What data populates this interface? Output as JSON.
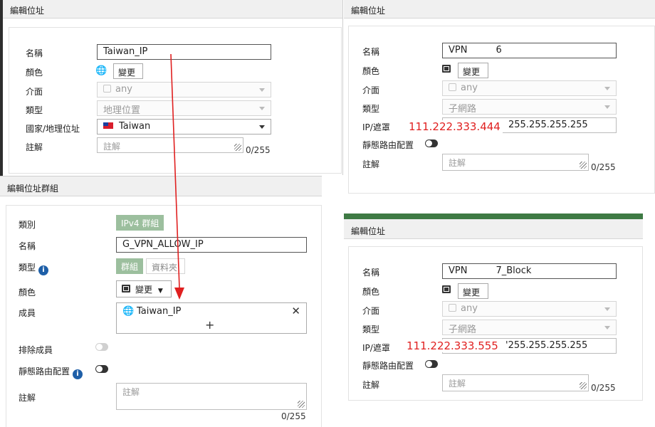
{
  "panel1": {
    "title": "編輯位址",
    "labels": {
      "name": "名稱",
      "color": "顏色",
      "interface": "介面",
      "type": "類型",
      "country": "國家/地理位址",
      "comment": "註解"
    },
    "name_value": "Taiwan_IP",
    "color_button": "變更",
    "interface_value": "any",
    "type_value": "地理位置",
    "country_value": "Taiwan",
    "comment_placeholder": "註解",
    "comment_counter": "0/255"
  },
  "panel2": {
    "title": "編輯位址",
    "labels": {
      "name": "名稱",
      "color": "顏色",
      "interface": "介面",
      "type": "類型",
      "ip": "IP/遮罩",
      "static_route": "靜態路由配置",
      "comment": "註解"
    },
    "name_prefix": "VPN",
    "name_suffix": "6",
    "color_button": "變更",
    "interface_value": "any",
    "type_value": "子網路",
    "ip_overlay": "111.222.333.444",
    "ip_mask_value": "255.255.255.255",
    "comment_placeholder": "註解",
    "comment_counter": "0/255"
  },
  "panel3": {
    "title": "編輯位址群組",
    "labels": {
      "category": "類別",
      "name": "名稱",
      "type": "類型",
      "color": "顏色",
      "members": "成員",
      "exclude": "排除成員",
      "static_route": "靜態路由配置",
      "comment": "註解"
    },
    "category_value": "IPv4 群組",
    "name_value": "G_VPN_ALLOW_IP",
    "type_options": [
      "群組",
      "資料夾"
    ],
    "color_button": "變更",
    "members": [
      "Taiwan_IP"
    ],
    "add_symbol": "+",
    "comment_placeholder": "註解",
    "comment_counter": "0/255"
  },
  "panel4": {
    "title": "編輯位址",
    "labels": {
      "name": "名稱",
      "color": "顏色",
      "interface": "介面",
      "type": "類型",
      "ip": "IP/遮罩",
      "static_route": "靜態路由配置",
      "comment": "註解"
    },
    "name_prefix": "VPN",
    "name_suffix": "7_Block",
    "color_button": "變更",
    "interface_value": "any",
    "type_value": "子網路",
    "ip_overlay": "111.222.333.555",
    "ip_mask_value": "'255.255.255.255",
    "comment_placeholder": "註解",
    "comment_counter": "0/255"
  },
  "colors": {
    "green_bar": "#3e7a44",
    "arrow": "#e02020",
    "annotation": "#e02020"
  }
}
